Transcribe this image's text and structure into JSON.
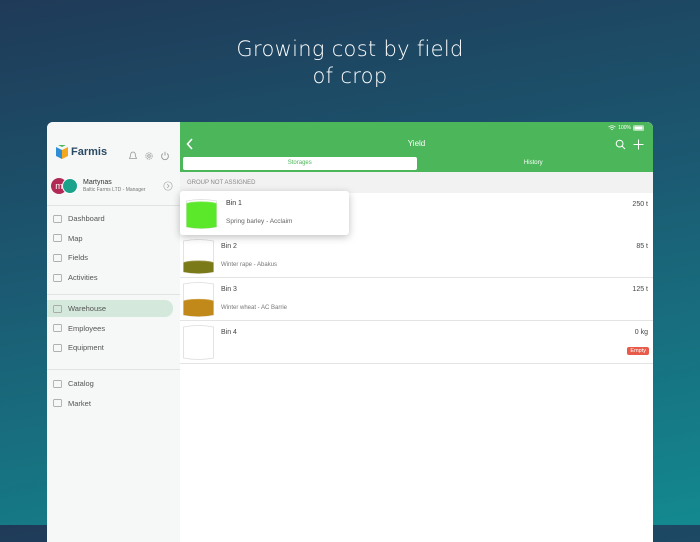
{
  "headline": {
    "line1": "Growing cost by field",
    "line2": "of crop"
  },
  "colors": {
    "accent": "#4cb65a",
    "barley": "#5be82b",
    "rape": "#7b7a18",
    "wheat": "#c1891a",
    "empty_badge": "#e85b4a"
  },
  "sidebar": {
    "logo": "Farmis",
    "top_icons": [
      "bell-icon",
      "gear-icon",
      "power-icon"
    ],
    "user": {
      "initial": "m",
      "name": "Martynas",
      "org": "Baltic Farms LTD - Manager"
    },
    "groups": [
      [
        {
          "label": "Dashboard",
          "icon": "dashboard-icon"
        },
        {
          "label": "Map",
          "icon": "map-icon"
        },
        {
          "label": "Fields",
          "icon": "fields-icon"
        },
        {
          "label": "Activities",
          "icon": "activities-icon"
        }
      ],
      [
        {
          "label": "Warehouse",
          "icon": "warehouse-icon",
          "active": true
        },
        {
          "label": "Employees",
          "icon": "employees-icon"
        },
        {
          "label": "Equipment",
          "icon": "equipment-icon"
        }
      ],
      [
        {
          "label": "Catalog",
          "icon": "catalog-icon"
        },
        {
          "label": "Market",
          "icon": "market-icon"
        }
      ]
    ]
  },
  "header": {
    "status": "100%",
    "title": "Yield",
    "tabs": [
      {
        "label": "Storages",
        "active": true
      },
      {
        "label": "History",
        "active": false
      }
    ]
  },
  "group_label": "GROUP NOT ASSIGNED",
  "bins": [
    {
      "name": "Bin 1",
      "crop": "Spring barley - Acclaim",
      "qty": "250 t",
      "fill": 0.9,
      "color": "#5be82b",
      "badge": ""
    },
    {
      "name": "Bin 2",
      "crop": "Winter rape - Abakus",
      "qty": "85 t",
      "fill": 0.3,
      "color": "#7b7a18",
      "badge": ""
    },
    {
      "name": "Bin 3",
      "crop": "Winter wheat - AC Barrie",
      "qty": "125 t",
      "fill": 0.45,
      "color": "#c1891a",
      "badge": ""
    },
    {
      "name": "Bin 4",
      "crop": "",
      "qty": "0 kg",
      "fill": 0,
      "color": "#ffffff",
      "badge": "Empty"
    }
  ]
}
